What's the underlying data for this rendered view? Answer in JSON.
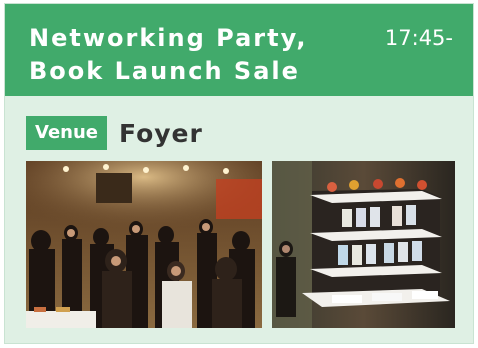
{
  "event": {
    "title_lines": [
      "Networking Party,",
      "Book Launch Sale"
    ],
    "time": "17:45-"
  },
  "venue": {
    "badge_label": "Venue",
    "name": "Foyer"
  },
  "photos": [
    {
      "subject": "party-crowd-photo"
    },
    {
      "subject": "book-display-photo"
    }
  ],
  "colors": {
    "accent": "#41aa6b",
    "card_background": "#dff0e4",
    "text_dark": "#333333"
  }
}
